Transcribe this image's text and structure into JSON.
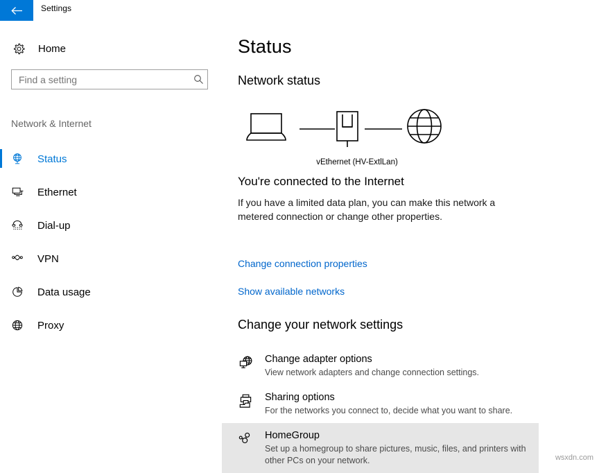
{
  "window": {
    "title": "Settings",
    "back_icon": "back-arrow-icon",
    "accent_color": "#0078d7"
  },
  "sidebar": {
    "home": {
      "label": "Home",
      "icon": "gear-icon"
    },
    "search": {
      "placeholder": "Find a setting",
      "value": "",
      "icon": "search-icon"
    },
    "category": "Network & Internet",
    "items": [
      {
        "label": "Status",
        "icon": "globe-network-icon",
        "selected": true
      },
      {
        "label": "Ethernet",
        "icon": "ethernet-icon",
        "selected": false
      },
      {
        "label": "Dial-up",
        "icon": "dialup-phone-icon",
        "selected": false
      },
      {
        "label": "VPN",
        "icon": "vpn-icon",
        "selected": false
      },
      {
        "label": "Data usage",
        "icon": "pie-chart-icon",
        "selected": false
      },
      {
        "label": "Proxy",
        "icon": "globe-icon",
        "selected": false
      }
    ]
  },
  "main": {
    "page_title": "Status",
    "network_status_heading": "Network status",
    "diagram": {
      "device_icon": "laptop-icon",
      "adapter_icon": "network-adapter-icon",
      "internet_icon": "globe-icon",
      "adapter_label": "vEthernet (HV-ExtlLan)"
    },
    "connection": {
      "title": "You're connected to the Internet",
      "description": "If you have a limited data plan, you can make this network a metered connection or change other properties."
    },
    "links": [
      {
        "label": "Change connection properties"
      },
      {
        "label": "Show available networks"
      }
    ],
    "change_settings_heading": "Change your network settings",
    "settings": [
      {
        "title": "Change adapter options",
        "description": "View network adapters and change connection settings.",
        "icon": "adapter-globe-icon",
        "highlighted": false
      },
      {
        "title": "Sharing options",
        "description": "For the networks you connect to, decide what you want to share.",
        "icon": "sharing-printer-folder-icon",
        "highlighted": false
      },
      {
        "title": "HomeGroup",
        "description": "Set up a homegroup to share pictures, music, files, and printers with other PCs on your network.",
        "icon": "homegroup-icon",
        "highlighted": true
      }
    ]
  },
  "watermark": "wsxdn.com"
}
